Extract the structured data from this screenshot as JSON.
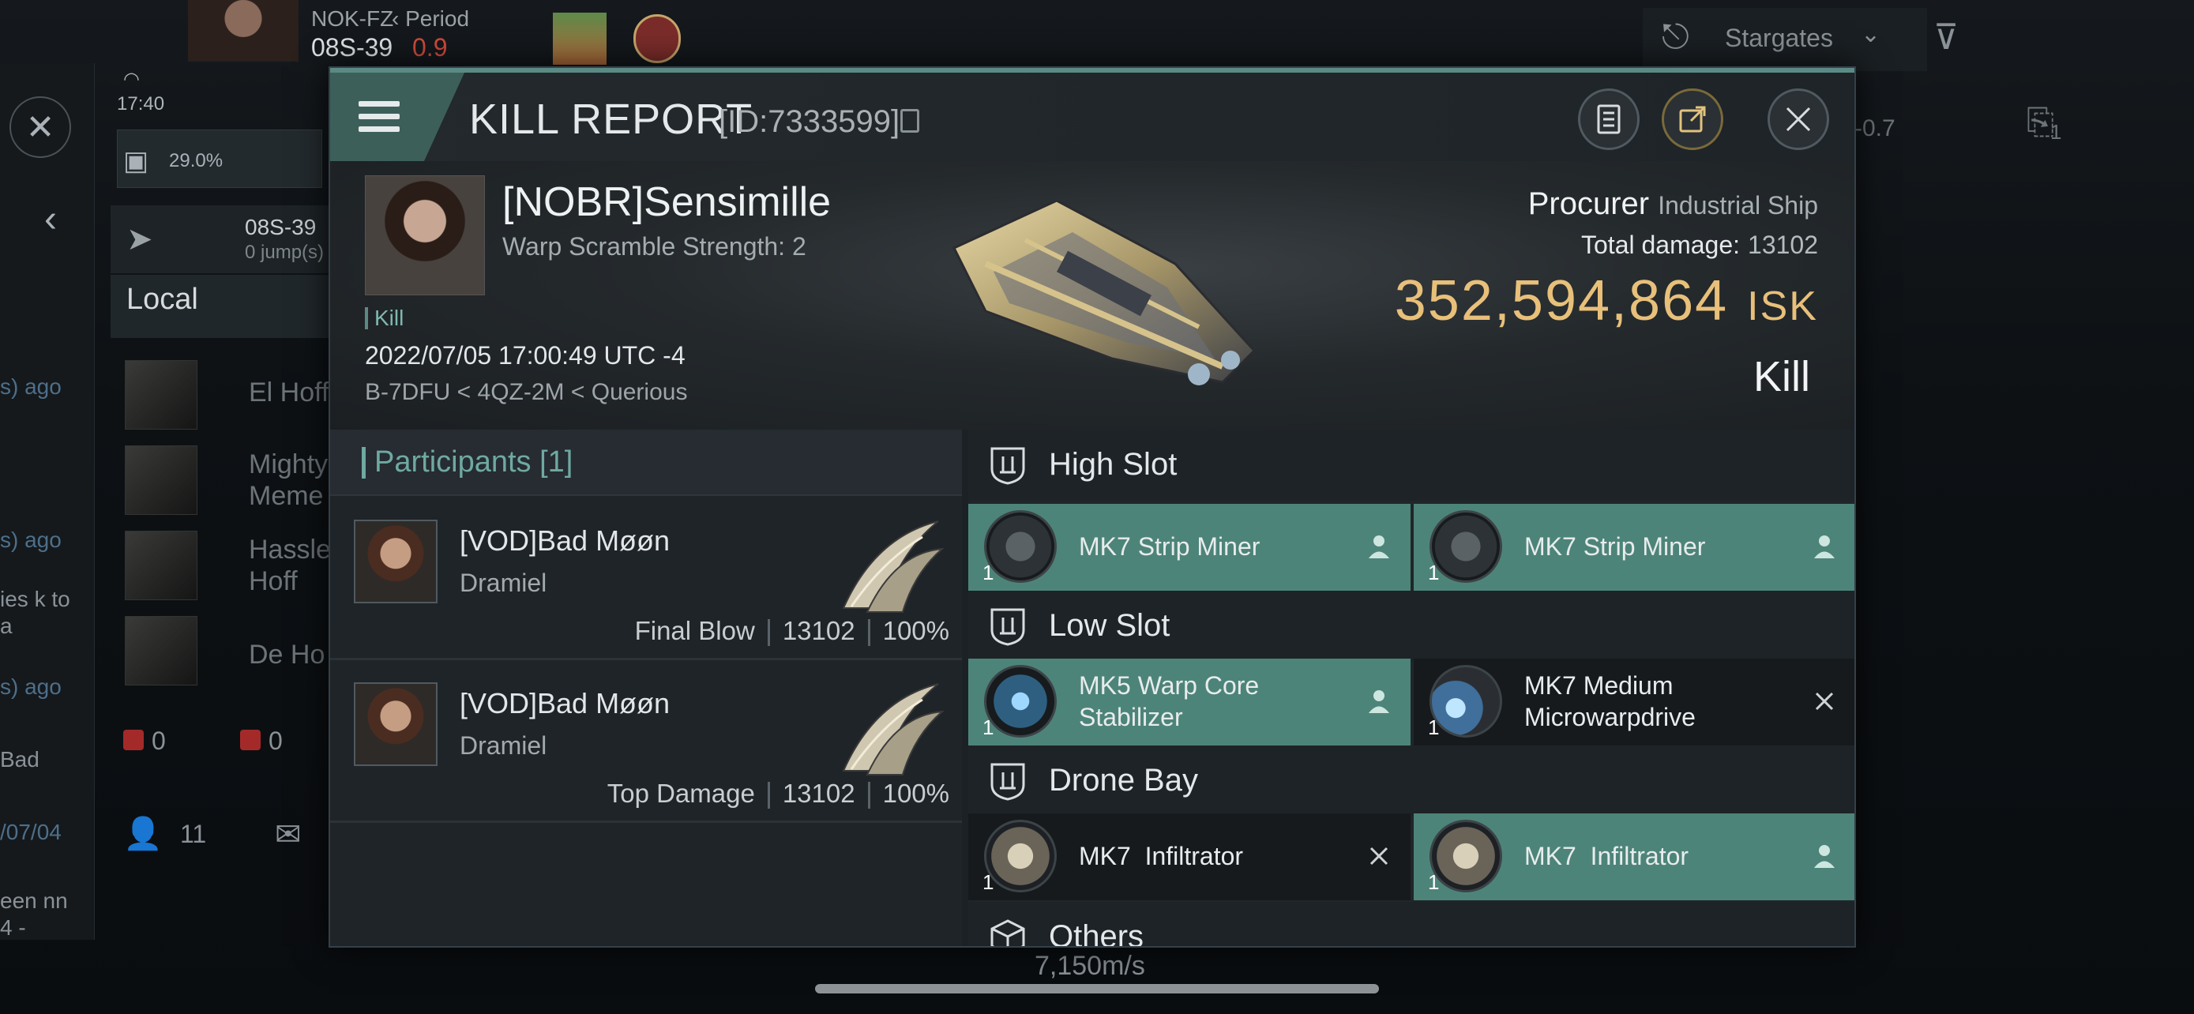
{
  "background": {
    "player_corp": "NOK-FZ",
    "period_label": "Period",
    "system": "08S-39",
    "security": "0.9",
    "time": "17:40",
    "cargo_percent": "29.0%",
    "nav_system": "08S-39",
    "nav_jumps": "0 jump(s)",
    "local_label": "Local",
    "chat_names": [
      "El Hoff",
      "Mighty Meme",
      "Hassle Hoff",
      "De Ho"
    ],
    "chat_snippets": [
      "s) ago",
      "s) ago",
      "ies k to a",
      "s) ago",
      "Bad",
      "/07/04",
      "een nn 4 -"
    ],
    "counter_a": "0",
    "counter_b": "0",
    "members_count": "11",
    "stargates_label": "Stargates",
    "right_value": "-0.7",
    "right_badge": "1",
    "speed": "7,150m/s"
  },
  "header": {
    "title": "KILL REPORT",
    "id": "[ID:7333599]"
  },
  "victim": {
    "name": "[NOBR]Sensimille",
    "warp_scramble": "Warp Scramble Strength: 2",
    "tag": "Kill",
    "datetime": "2022/07/05 17:00:49 UTC -4",
    "location": "B-7DFU < 4QZ-2M < Querious",
    "ship": "Procurer",
    "ship_class": "Industrial Ship",
    "total_damage_label": "Total damage:",
    "total_damage": "13102",
    "isk_value": "352,594,864",
    "isk_unit": "ISK",
    "result": "Kill"
  },
  "participants": {
    "title": "Participants [1]",
    "rows": [
      {
        "name": "[VOD]Bad Møøn",
        "ship": "Dramiel",
        "role": "Final Blow",
        "damage": "13102",
        "percent": "100%"
      },
      {
        "name": "[VOD]Bad Møøn",
        "ship": "Dramiel",
        "role": "Top Damage",
        "damage": "13102",
        "percent": "100%"
      }
    ]
  },
  "modules": {
    "high": {
      "title": "High Slot",
      "items": [
        {
          "name": "MK7 Strip Miner",
          "qty": "1",
          "status": "dropped"
        },
        {
          "name": "MK7 Strip Miner",
          "qty": "1",
          "status": "dropped"
        }
      ]
    },
    "low": {
      "title": "Low Slot",
      "items": [
        {
          "name": "MK5 Warp Core Stabilizer",
          "qty": "1",
          "status": "dropped"
        },
        {
          "name": "MK7 Medium Microwarpdrive",
          "qty": "1",
          "status": "destroyed"
        }
      ]
    },
    "drone": {
      "title": "Drone Bay",
      "items": [
        {
          "name": "MK7  Infiltrator",
          "qty": "1",
          "status": "destroyed"
        },
        {
          "name": "MK7  Infiltrator",
          "qty": "1",
          "status": "dropped"
        }
      ]
    },
    "others": {
      "title": "Others"
    }
  },
  "colors": {
    "accent": "#5b8a84",
    "dropped_bg": "#4d8479",
    "isk": "#e8c07a"
  }
}
